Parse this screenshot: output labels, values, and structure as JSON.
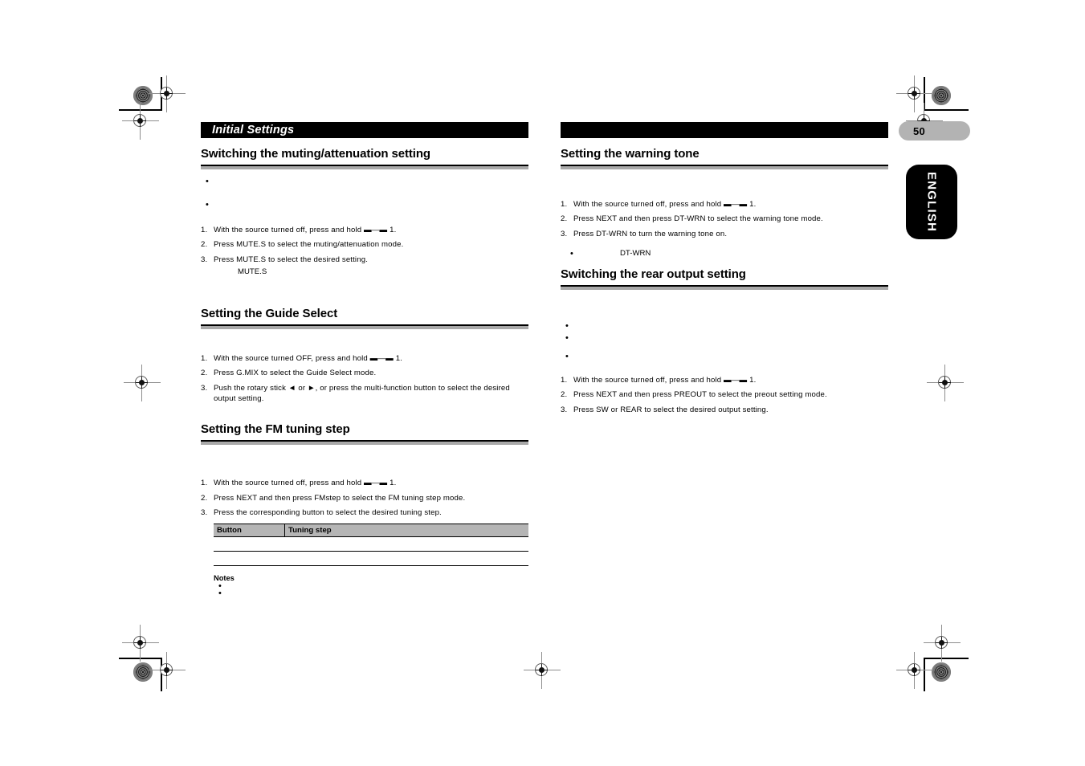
{
  "page": {
    "number": "50",
    "language_tab": "ENGLISH",
    "chapter_title": "Initial Settings"
  },
  "left_column": {
    "sections": [
      {
        "title": "Switching the muting/attenuation setting",
        "bullets": [
          "",
          ""
        ],
        "steps": [
          "With the source turned off, press and hold ▬—▬ 1.",
          "Press MUTE.S to select the muting/attenuation mode.",
          "Press MUTE.S to select the desired setting."
        ],
        "sub_line": "MUTE.S"
      },
      {
        "title": "Setting the Guide Select",
        "steps": [
          "With the source turned OFF, press and hold ▬—▬ 1.",
          "Press G.MIX to select the Guide Select mode.",
          "Push the rotary stick ◄ or ►, or press the multi-function button to select the desired output setting."
        ]
      },
      {
        "title": "Setting the FM tuning step",
        "steps": [
          "With the source turned off, press and hold ▬—▬ 1.",
          "Press NEXT and then press FMstep to select the FM tuning step mode.",
          "Press the corresponding button to select the desired tuning step."
        ],
        "table": {
          "headers": [
            "Button",
            "Tuning step"
          ],
          "rows": [
            [
              "",
              ""
            ],
            [
              "",
              ""
            ]
          ]
        },
        "notes_title": "Notes",
        "notes": [
          "",
          ""
        ]
      }
    ]
  },
  "right_column": {
    "sections": [
      {
        "title": "Setting the warning tone",
        "steps": [
          "With the source turned off, press and hold ▬—▬ 1.",
          "Press NEXT and then press DT-WRN to select the warning tone mode.",
          "Press DT-WRN to turn the warning tone on."
        ],
        "indent_bullet": "DT-WRN"
      },
      {
        "title": "Switching the rear output setting",
        "bullets": [
          "",
          "",
          ""
        ],
        "steps": [
          "With the source turned off, press and hold ▬—▬ 1.",
          "Press NEXT and then press PREOUT to select the preout setting mode.",
          "Press SW or REAR to select the desired output setting."
        ]
      }
    ]
  }
}
